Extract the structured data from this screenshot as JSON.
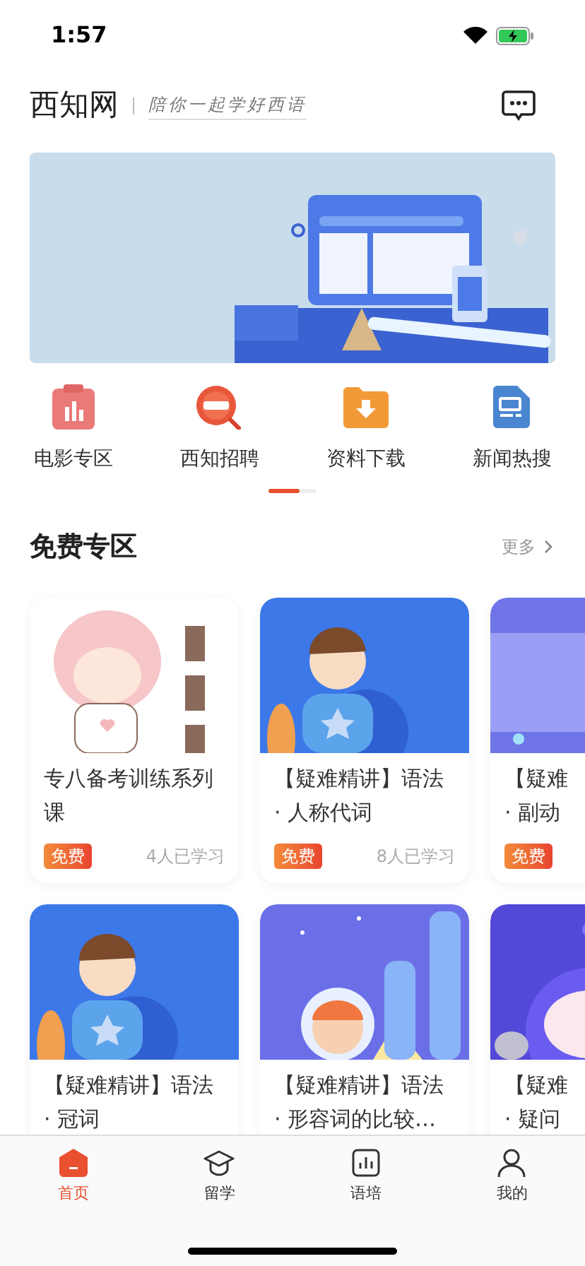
{
  "status_bar": {
    "time": "1:57"
  },
  "header": {
    "title": "西知网",
    "tagline": "陪你一起学好西语"
  },
  "shortcuts": [
    {
      "label": "电影专区"
    },
    {
      "label": "西知招聘"
    },
    {
      "label": "资料下载"
    },
    {
      "label": "新闻热搜"
    }
  ],
  "section": {
    "title": "免费专区",
    "more": "更多"
  },
  "cards": [
    {
      "title_lines": [
        "专八备考训练系列",
        "课"
      ],
      "badge": "免费",
      "learners": "4人已学习"
    },
    {
      "title_lines": [
        "【疑难精讲】语法",
        "· 人称代词"
      ],
      "badge": "免费",
      "learners": "8人已学习"
    },
    {
      "title_lines": [
        "【疑难",
        "· 副动"
      ],
      "badge": "免费"
    },
    {
      "title_lines": [
        "【疑难精讲】语法",
        "· 冠词"
      ]
    },
    {
      "title_lines": [
        "【疑难精讲】语法",
        "· 形容词的比较…"
      ]
    },
    {
      "title_lines": [
        "【疑难",
        "· 疑问"
      ]
    }
  ],
  "tab_bar": [
    {
      "label": "首页",
      "selected": true
    },
    {
      "label": "留学",
      "selected": false
    },
    {
      "label": "语培",
      "selected": false
    },
    {
      "label": "我的",
      "selected": false
    }
  ]
}
